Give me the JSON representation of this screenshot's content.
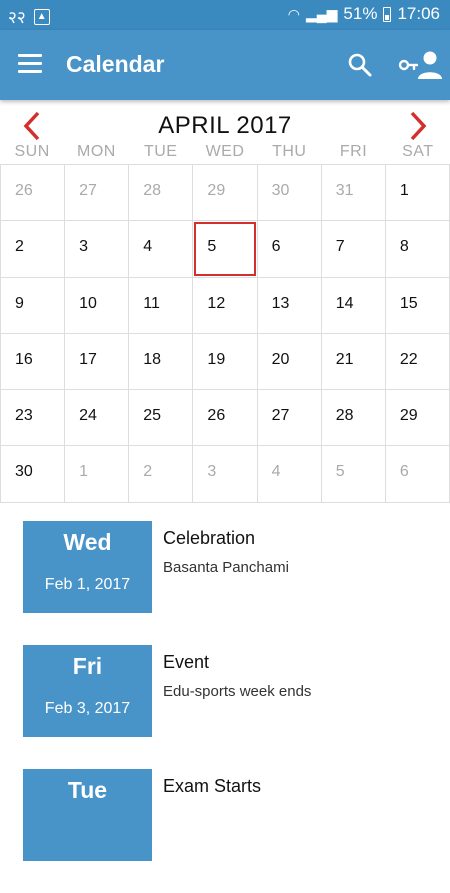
{
  "status": {
    "battery": "51%",
    "time": "17:06",
    "network": "२२"
  },
  "app_bar": {
    "title": "Calendar"
  },
  "calendar": {
    "month_title": "APRIL 2017",
    "weekdays": [
      "SUN",
      "MON",
      "TUE",
      "WED",
      "THU",
      "FRI",
      "SAT"
    ],
    "weeks": [
      [
        "26",
        "27",
        "28",
        "29",
        "30",
        "31",
        "1"
      ],
      [
        "2",
        "3",
        "4",
        "5",
        "6",
        "7",
        "8"
      ],
      [
        "9",
        "10",
        "11",
        "12",
        "13",
        "14",
        "15"
      ],
      [
        "16",
        "17",
        "18",
        "19",
        "20",
        "21",
        "22"
      ],
      [
        "23",
        "24",
        "25",
        "26",
        "27",
        "28",
        "29"
      ],
      [
        "30",
        "1",
        "2",
        "3",
        "4",
        "5",
        "6"
      ]
    ],
    "today": "5"
  },
  "events": [
    {
      "day": "Wed",
      "date": "Feb 1, 2017",
      "title": "Celebration",
      "desc": "Basanta Panchami"
    },
    {
      "day": "Fri",
      "date": "Feb 3, 2017",
      "title": "Event",
      "desc": "Edu-sports week ends"
    },
    {
      "day": "Tue",
      "date": "",
      "title": "Exam Starts",
      "desc": ""
    }
  ],
  "colors": {
    "primary": "#4893c8",
    "status_bar": "#3a89bf",
    "accent": "#d32f2f"
  }
}
